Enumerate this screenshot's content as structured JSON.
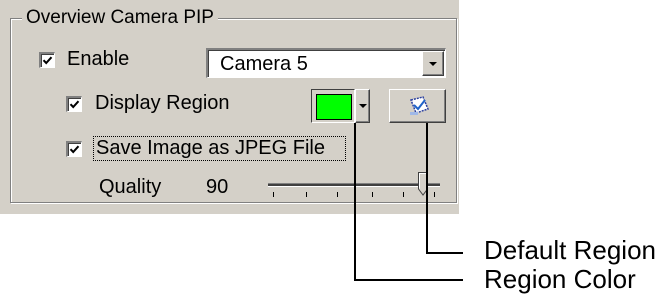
{
  "groupbox": {
    "title": "Overview Camera PIP"
  },
  "enable": {
    "label": "Enable",
    "checked": true,
    "camera_value": "Camera 5"
  },
  "display_region": {
    "label": "Display Region",
    "checked": true,
    "region_color": "#00ff00"
  },
  "save_jpeg": {
    "label": "Save Image as JPEG File",
    "checked": true
  },
  "quality": {
    "label": "Quality",
    "value": "90",
    "slider_fraction": 0.9
  },
  "icons": {
    "checkmark": "checkmark-icon",
    "dropdown": "chevron-down-icon",
    "default_region": "default-region-icon"
  },
  "callouts": {
    "default_region": "Default Region",
    "region_color": "Region Color"
  }
}
